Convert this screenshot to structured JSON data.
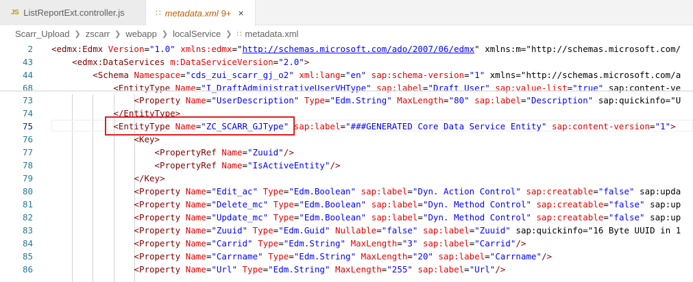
{
  "tabs": [
    {
      "icon": "JS",
      "label": "ListReportExt.controller.js",
      "active": false
    },
    {
      "icon": "rss-icon",
      "label": "metadata.xml",
      "badge": "9+",
      "active": true,
      "close": "×"
    }
  ],
  "breadcrumb": [
    "Scarr_Upload",
    "zscarr",
    "webapp",
    "localService",
    "metadata.xml"
  ],
  "editor": {
    "sticky_lines": [
      {
        "num": "2",
        "text": "<edmx:Edmx Version=\"1.0\" xmlns:edmx=\"http://schemas.microsoft.com/ado/2007/06/edmx\" xmlns:m=\"http://schemas.microsoft.com/"
      },
      {
        "num": "43",
        "text": "    <edmx:DataServices m:DataServiceVersion=\"2.0\">"
      },
      {
        "num": "44",
        "text": "        <Schema Namespace=\"cds_zui_scarr_gj_o2\" xml:lang=\"en\" sap:schema-version=\"1\" xmlns=\"http://schemas.microsoft.com/a"
      },
      {
        "num": "68",
        "text": "            <EntityType Name=\"I_DraftAdministrativeUserVHType\" sap:label=\"Draft User\" sap:value-list=\"true\" sap:content-ve"
      }
    ],
    "lines": [
      {
        "num": "73",
        "text": "                <Property Name=\"UserDescription\" Type=\"Edm.String\" MaxLength=\"80\" sap:label=\"Description\" sap:quickinfo=\"U"
      },
      {
        "num": "74",
        "text": "            </EntityType>"
      },
      {
        "num": "75",
        "text": "            <EntityType Name=\"ZC_SCARR_GJType\" sap:label=\"###GENERATED Core Data Service Entity\" sap:content-version=\"1\">"
      },
      {
        "num": "76",
        "text": "                <Key>"
      },
      {
        "num": "77",
        "text": "                    <PropertyRef Name=\"Zuuid\"/>"
      },
      {
        "num": "78",
        "text": "                    <PropertyRef Name=\"IsActiveEntity\"/>"
      },
      {
        "num": "79",
        "text": "                </Key>"
      },
      {
        "num": "80",
        "text": "                <Property Name=\"Edit_ac\" Type=\"Edm.Boolean\" sap:label=\"Dyn. Action Control\" sap:creatable=\"false\" sap:upda"
      },
      {
        "num": "81",
        "text": "                <Property Name=\"Delete_mc\" Type=\"Edm.Boolean\" sap:label=\"Dyn. Method Control\" sap:creatable=\"false\" sap:up"
      },
      {
        "num": "82",
        "text": "                <Property Name=\"Update_mc\" Type=\"Edm.Boolean\" sap:label=\"Dyn. Method Control\" sap:creatable=\"false\" sap:up"
      },
      {
        "num": "83",
        "text": "                <Property Name=\"Zuuid\" Type=\"Edm.Guid\" Nullable=\"false\" sap:label=\"Zuuid\" sap:quickinfo=\"16 Byte UUID in 1"
      },
      {
        "num": "84",
        "text": "                <Property Name=\"Carrid\" Type=\"Edm.String\" MaxLength=\"3\" sap:label=\"Carrid\"/>"
      },
      {
        "num": "85",
        "text": "                <Property Name=\"Carrname\" Type=\"Edm.String\" MaxLength=\"20\" sap:label=\"Carrname\"/>"
      },
      {
        "num": "86",
        "text": "                <Property Name=\"Url\" Type=\"Edm.String\" MaxLength=\"255\" sap:label=\"Url\"/>"
      }
    ],
    "active_line": "75",
    "highlighted_text": "<EntityType Name=\"ZC_SCARR_GJType\""
  },
  "colors": {
    "tag": "#800000",
    "attribute": "#e50000",
    "value": "#0000ff",
    "line_number": "#237893",
    "highlight_box": "#e21b1b"
  }
}
